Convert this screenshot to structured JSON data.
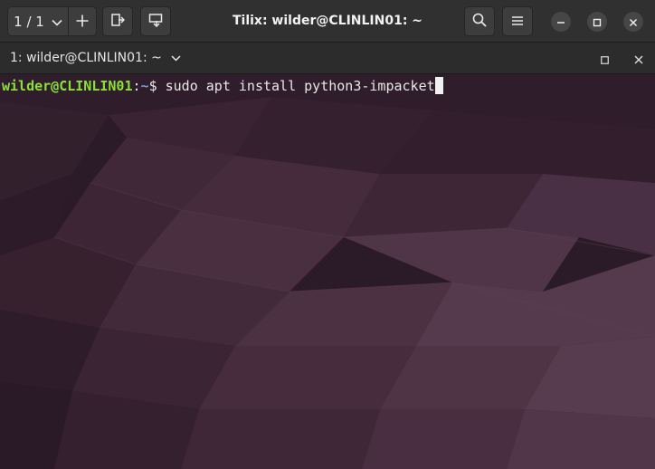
{
  "window": {
    "title": "Tilix: wilder@CLINLIN01: ~"
  },
  "header": {
    "session_switcher": "1 / 1",
    "session_switcher_icon": "chevron-down-icon",
    "add_session_icon": "plus-icon",
    "split_right_icon": "split-right-icon",
    "split_down_icon": "split-down-icon",
    "search_icon": "search-icon",
    "menu_icon": "hamburger-menu-icon",
    "window_controls": [
      "minimize-icon",
      "maximize-icon",
      "close-icon"
    ]
  },
  "terminal_tab": {
    "title": "1: wilder@CLINLIN01: ~",
    "dropdown_icon": "chevron-down-icon",
    "controls": [
      "maximize-icon",
      "close-icon"
    ]
  },
  "terminal": {
    "prompt_user_host": "wilder@CLINLIN01",
    "prompt_separator": ":",
    "prompt_path": "~",
    "prompt_symbol": "$ ",
    "command": "sudo apt install python3-impacket"
  },
  "colors": {
    "headerbar": "#303030",
    "termbar": "#2c2c2c",
    "terminal_bg": "#2a1a26",
    "prompt_user": "#8ae234",
    "prompt_path": "#729fcf",
    "text": "#e8e8e8"
  }
}
